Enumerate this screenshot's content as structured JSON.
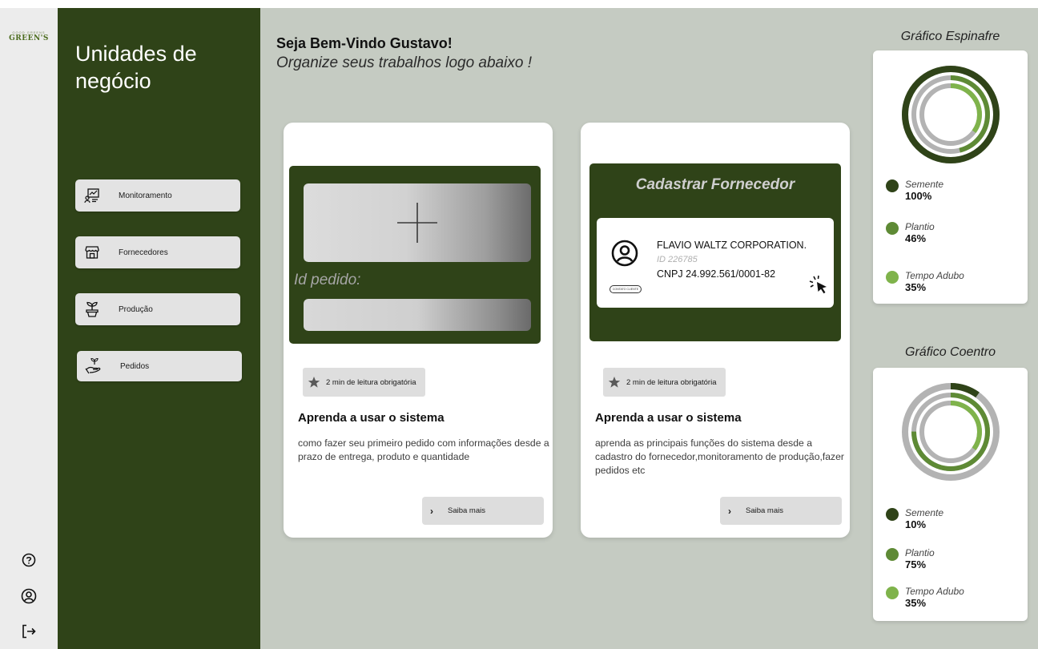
{
  "logo": {
    "brand": "GREEN'S",
    "tagline": "GOOD GREENS"
  },
  "sidebar": {
    "title": "Unidades de negócio",
    "items": [
      {
        "label": "Monitoramento",
        "icon": "monitoring-icon"
      },
      {
        "label": "Fornecedores",
        "icon": "store-icon"
      },
      {
        "label": "Produção",
        "icon": "plant-pot-icon"
      },
      {
        "label": "Pedidos",
        "icon": "hand-plant-icon"
      }
    ]
  },
  "rail": {
    "icons": [
      "help-icon",
      "user-icon",
      "logout-icon"
    ]
  },
  "header": {
    "welcome": "Seja Bem-Vindo Gustavo!",
    "subtitle": "Organize seus trabalhos logo abaixo !"
  },
  "cards": [
    {
      "hero": {
        "id_label": "Id pedido:"
      },
      "badge": "2 min de leitura obrigatória",
      "title": "Aprenda a usar o sistema",
      "description": "como fazer seu primeiro pedido com informações desde a prazo de entrega, produto e quantidade",
      "button": "Saiba mais"
    },
    {
      "hero": {
        "title": "Cadastrar Fornecedor",
        "supplier_name": "FLAVIO WALTZ CORPORATION.",
        "supplier_id": "ID 226785",
        "supplier_cnpj": "CNPJ 24.992.561/0001-82",
        "supplier_tag": "CONTATO CLIENTE"
      },
      "badge": "2 min de leitura obrigatória",
      "title": "Aprenda a usar o sistema",
      "description": "aprenda as principais funções do sistema desde a cadastro do fornecedor,monitoramento de produção,fazer pedidos etc",
      "button": "Saiba mais"
    }
  ],
  "charts": [
    {
      "title": "Gráfico Espinafre",
      "items": [
        {
          "name": "Semente",
          "value": "100%",
          "percent": 100,
          "color": "#2f4318"
        },
        {
          "name": "Plantio",
          "value": "46%",
          "percent": 46,
          "color": "#5e8a35"
        },
        {
          "name": "Tempo Adubo",
          "value": "35%",
          "percent": 35,
          "color": "#7fb34b"
        }
      ]
    },
    {
      "title": "Gráfico Coentro",
      "items": [
        {
          "name": "Semente",
          "value": "10%",
          "percent": 10,
          "color": "#2f4318"
        },
        {
          "name": "Plantio",
          "value": "75%",
          "percent": 75,
          "color": "#5e8a35"
        },
        {
          "name": "Tempo Adubo",
          "value": "35%",
          "percent": 35,
          "color": "#7fb34b"
        }
      ]
    }
  ],
  "colors": {
    "sidebar": "#2f4318",
    "background": "#c5cbc2",
    "track": "#b3b3b3"
  }
}
